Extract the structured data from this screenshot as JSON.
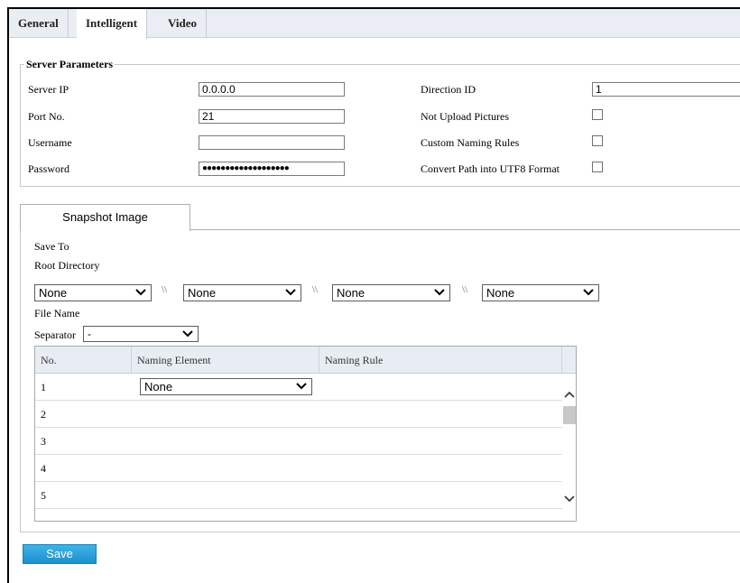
{
  "tabs": [
    "General",
    "Intelligent",
    "Video"
  ],
  "server": {
    "legend": "Server Parameters",
    "server_ip_label": "Server IP",
    "server_ip_value": "0.0.0.0",
    "port_label": "Port No.",
    "port_value": "21",
    "username_label": "Username",
    "username_value": "",
    "password_label": "Password",
    "password_value": "●●●●●●●●●●●●●●●●●●●",
    "direction_label": "Direction ID",
    "direction_value": "1",
    "not_upload_label": "Not Upload Pictures",
    "custom_naming_label": "Custom Naming Rules",
    "utf8_label": "Convert Path into UTF8 Format"
  },
  "snapshot": {
    "tab_label": "Snapshot Image",
    "save_to_label": "Save To",
    "root_dir_label": "Root Directory",
    "dir_selects": [
      "None",
      "None",
      "None",
      "None"
    ],
    "separator_glyph": "\\\\",
    "file_name_label": "File Name",
    "separator_label": "Separator",
    "separator_value": "-"
  },
  "table": {
    "headers": [
      "No.",
      "Naming Element",
      "Naming Rule"
    ],
    "rows": [
      "1",
      "2",
      "3",
      "4",
      "5"
    ],
    "row1_element": "None"
  },
  "save_label": "Save"
}
